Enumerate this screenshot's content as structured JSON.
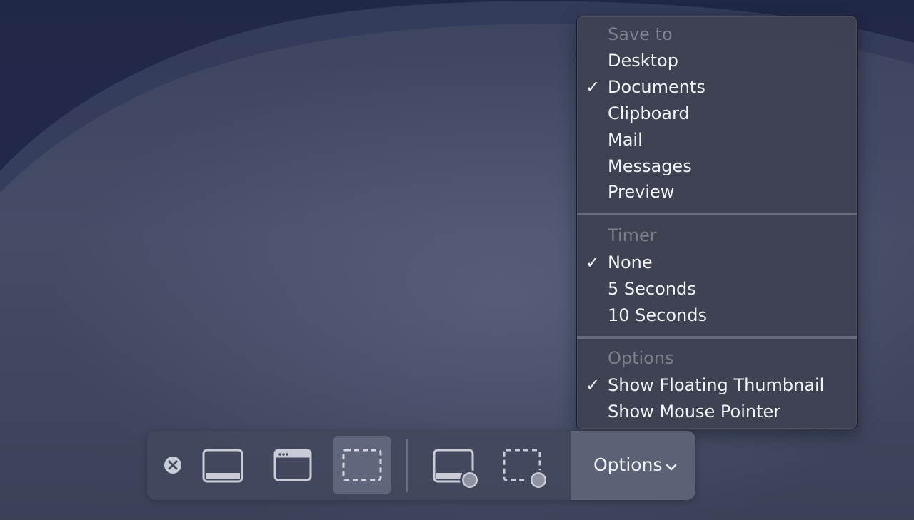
{
  "menu": {
    "save_to": {
      "header": "Save to",
      "items": [
        {
          "label": "Desktop",
          "checked": false
        },
        {
          "label": "Documents",
          "checked": true
        },
        {
          "label": "Clipboard",
          "checked": false
        },
        {
          "label": "Mail",
          "checked": false
        },
        {
          "label": "Messages",
          "checked": false
        },
        {
          "label": "Preview",
          "checked": false
        }
      ]
    },
    "timer": {
      "header": "Timer",
      "items": [
        {
          "label": "None",
          "checked": true
        },
        {
          "label": "5 Seconds",
          "checked": false
        },
        {
          "label": "10 Seconds",
          "checked": false
        }
      ]
    },
    "options": {
      "header": "Options",
      "items": [
        {
          "label": "Show Floating Thumbnail",
          "checked": true
        },
        {
          "label": "Show Mouse Pointer",
          "checked": false
        }
      ]
    },
    "check_glyph": "✓"
  },
  "toolbar": {
    "buttons": [
      {
        "name": "close-button",
        "icon": "close-circle-icon"
      },
      {
        "name": "capture-entire-screen-button",
        "icon": "screen-icon"
      },
      {
        "name": "capture-window-button",
        "icon": "window-icon"
      },
      {
        "name": "capture-selection-button",
        "icon": "dashed-selection-icon",
        "selected": true
      },
      {
        "name": "record-entire-screen-button",
        "icon": "screen-record-icon"
      },
      {
        "name": "record-selection-button",
        "icon": "selection-record-icon"
      }
    ],
    "options_label": "Options",
    "options_icon": "chevron-down-icon"
  },
  "colors": {
    "menu_bg": "#3e4252",
    "menu_text": "#f2f3f7",
    "menu_header": "#7d8190",
    "toolbar_bg": "#42485c",
    "icon": "#c9ccd6"
  }
}
